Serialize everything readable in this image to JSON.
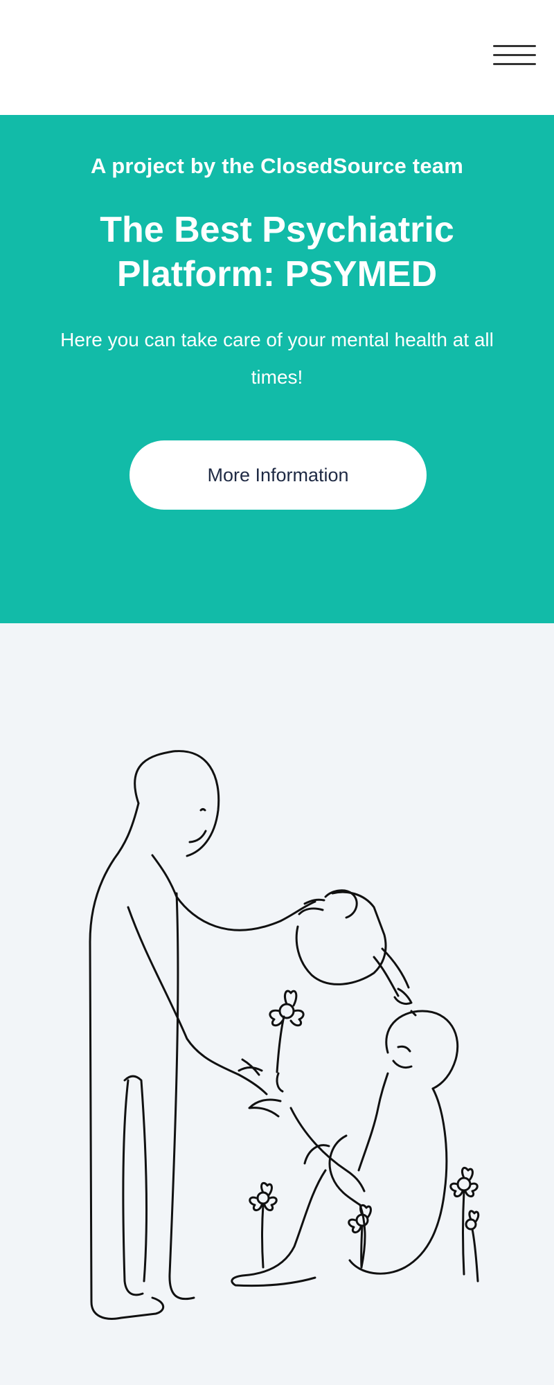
{
  "header": {
    "menu_icon": "hamburger-menu-icon"
  },
  "hero": {
    "kicker": "A project by the ClosedSource team",
    "title": "The Best Psychiatric Platform: PSYMED",
    "description": "Here you can take care of your mental health at all times!",
    "cta_label": "More Information",
    "background_color": "#12bba8",
    "text_color": "#ffffff"
  },
  "illustration": {
    "icon": "person-watering-person-illustration",
    "background_color": "#f2f5f8"
  }
}
